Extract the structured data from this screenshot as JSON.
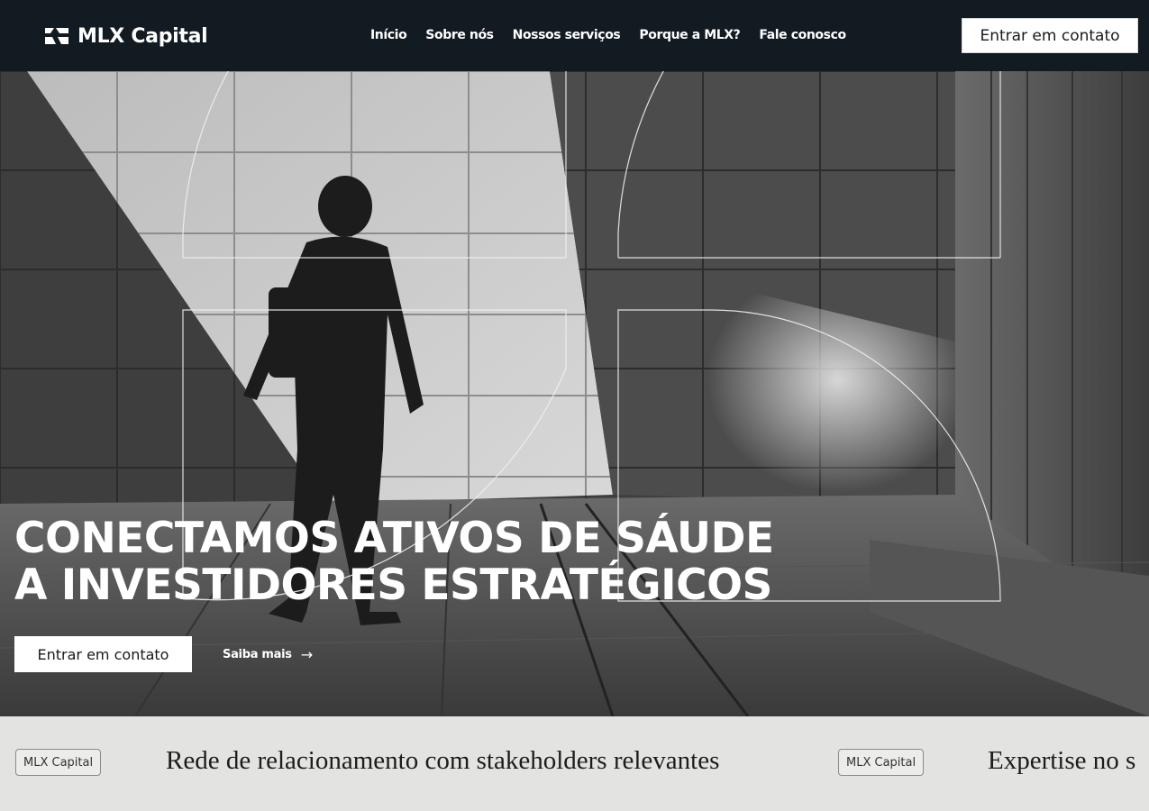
{
  "header": {
    "brand": "MLX Capital",
    "nav": [
      "Início",
      "Sobre nós",
      "Nossos serviços",
      "Porque a MLX?",
      "Fale conosco"
    ],
    "cta": "Entrar em contato"
  },
  "hero": {
    "title_line1": "CONECTAMOS ATIVOS DE SÁUDE",
    "title_line2": "A INVESTIDORES ESTRATÉGICOS",
    "cta": "Entrar em contato",
    "link": "Saiba mais"
  },
  "band": {
    "items": [
      {
        "tag": "MLX Capital",
        "text": "Rede de relacionamento com stakeholders relevantes"
      },
      {
        "tag": "MLX Capital",
        "text": "Expertise no s"
      }
    ]
  },
  "colors": {
    "header_bg": "#121a22",
    "band_bg": "#e3e3e1",
    "cta_bg": "#ffffff"
  },
  "icons": {
    "logo": "mlx-logo-mark",
    "link_arrow": "arrow-right-icon"
  }
}
